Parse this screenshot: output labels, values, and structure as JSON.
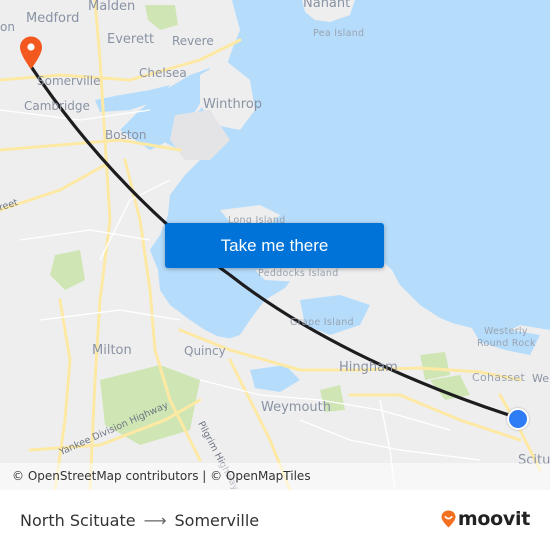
{
  "map": {
    "labels": {
      "medford": "Medford",
      "malden": "Malden",
      "everett": "Everett",
      "revere": "Revere",
      "chelsea": "Chelsea",
      "somerville": "Somerville",
      "cambridge": "Cambridge",
      "boston": "Boston",
      "winthrop": "Winthrop",
      "nahant": "Nahant",
      "pea_island": "Pea Island",
      "long_island": "Long Island",
      "peddocks_island": "Peddocks Island",
      "grape_island": "Grape Island",
      "westerly_round_rock_1": "Westerly",
      "westerly_round_rock_2": "Round Rock",
      "cohasset": "Cohasset",
      "hingham": "Hingham",
      "milton": "Milton",
      "quincy": "Quincy",
      "weymouth": "Weymouth",
      "scituate_partial": "Scitu",
      "wellesley_partial": "Wel",
      "on_partial": "on",
      "street_partial": "reet",
      "yankee_division_highway": "Yankee Division Highway",
      "pilgrim_highway": "Pilgrim Highway"
    },
    "cta_label": "Take me there",
    "attribution": "© OpenStreetMap contributors | © OpenMapTiles",
    "colors": {
      "water": "#b5dcfb",
      "land": "#eeeeef",
      "park": "#cfe6b4",
      "road": "#fde9a3",
      "route": "#1d1d1f",
      "destination_pin": "#f3581e",
      "origin_dot": "#2e7cf6",
      "button": "#0073d9"
    }
  },
  "footer": {
    "origin": "North Scituate",
    "arrow": "⟶",
    "destination": "Somerville",
    "brand": "moovit"
  }
}
